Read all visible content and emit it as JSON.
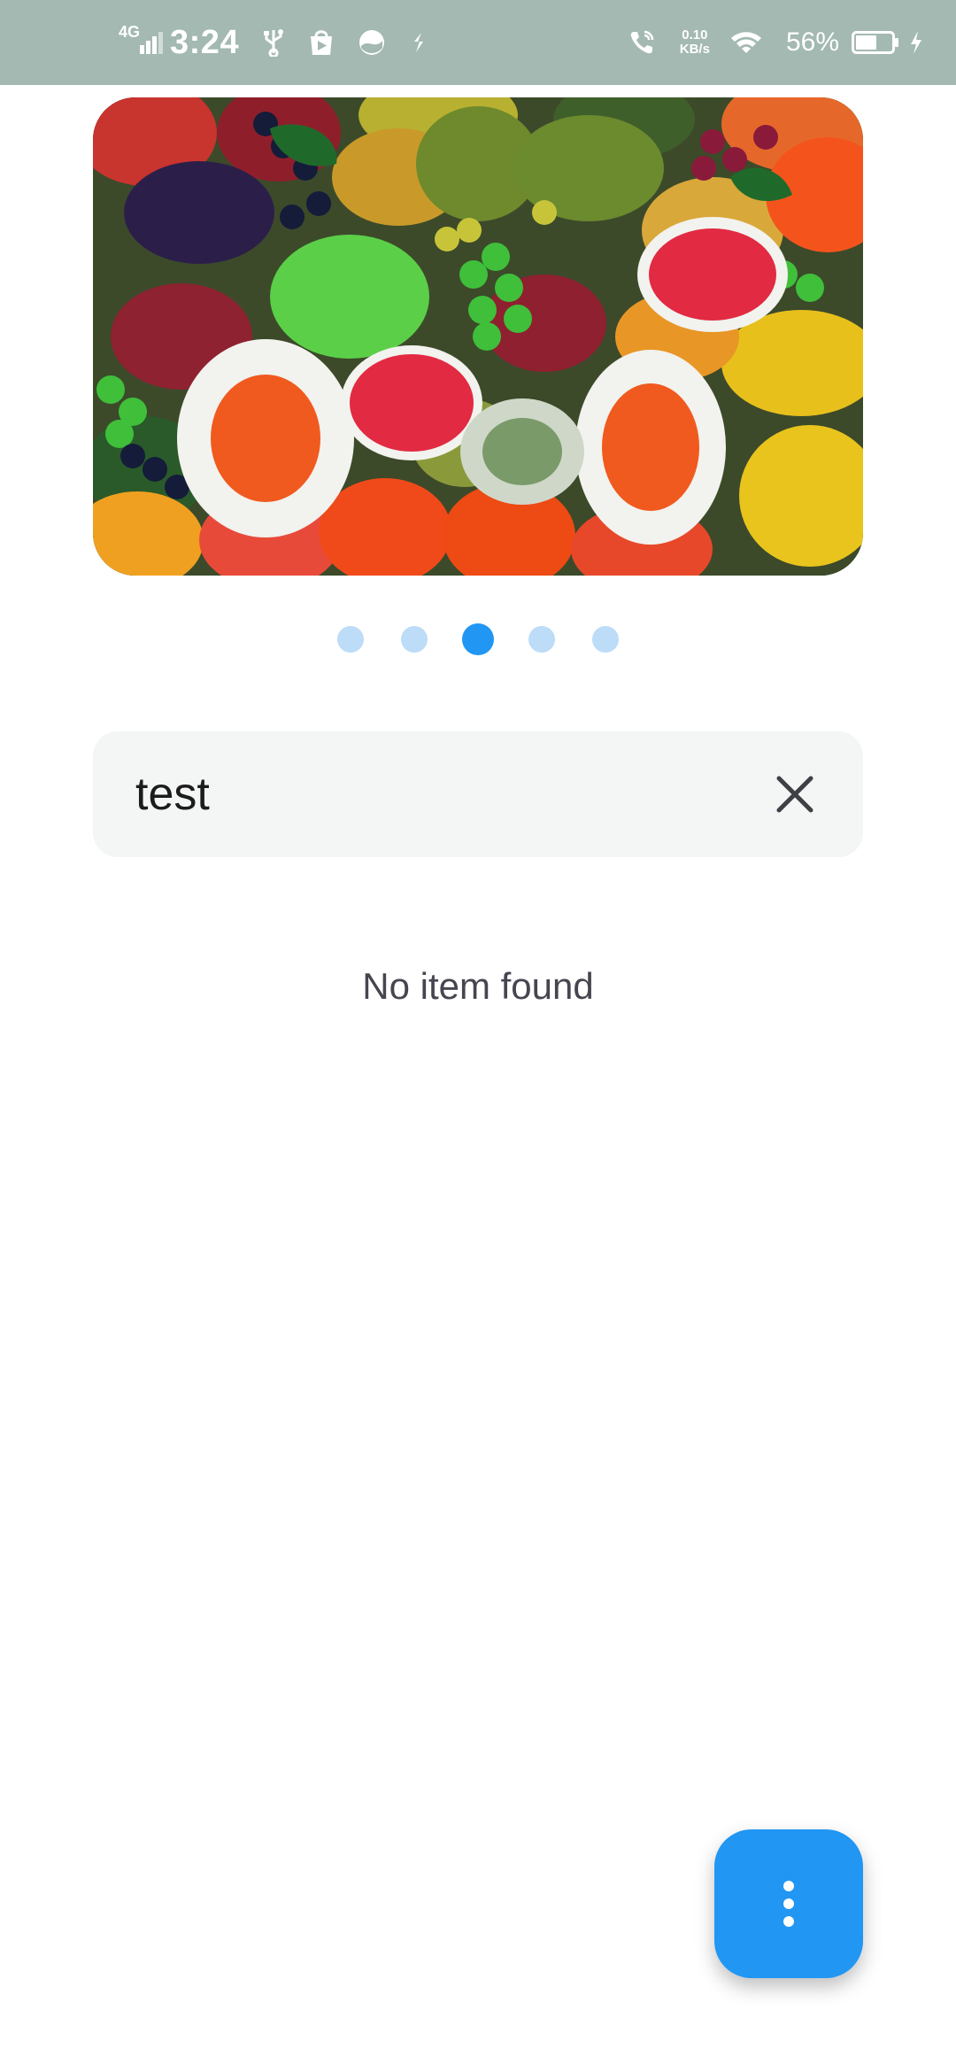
{
  "status_bar": {
    "network_type": "4G",
    "time": "3:24",
    "speed_value": "0.10",
    "speed_unit": "KB/s",
    "battery_percent": "56%",
    "icons": [
      "signal-icon",
      "usb-icon",
      "store-icon",
      "circle-app-icon",
      "sync-icon",
      "wifi-call-icon",
      "wifi-icon",
      "battery-icon",
      "charging-icon"
    ],
    "background_color": "#a3b9b2"
  },
  "carousel": {
    "image_subject": "assorted fruit",
    "page_count": 5,
    "active_page": 3
  },
  "search": {
    "value": "test",
    "placeholder": ""
  },
  "results": {
    "empty_message": "No item found"
  },
  "fab": {
    "icon": "more-vertical-icon",
    "color": "#2196f3"
  },
  "colors": {
    "accent": "#2196f3",
    "dot_inactive": "#bcdcf8"
  }
}
